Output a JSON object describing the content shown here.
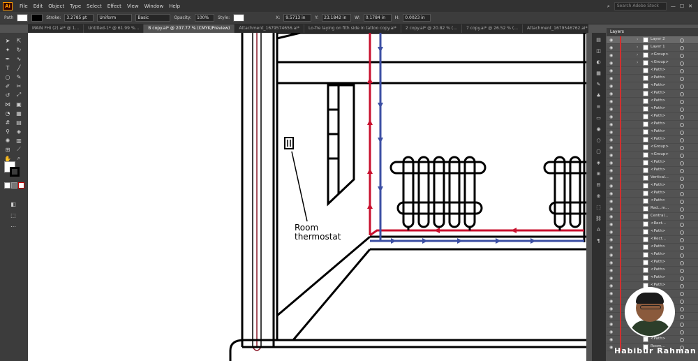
{
  "app": {
    "logo": "Ai"
  },
  "menu": [
    "File",
    "Edit",
    "Object",
    "Type",
    "Select",
    "Effect",
    "View",
    "Window",
    "Help"
  ],
  "search": {
    "placeholder": "Search Adobe Stock"
  },
  "control_bar": {
    "path_label": "Path",
    "stroke_label": "Stroke:",
    "stroke_value": "3.2785 pt",
    "profile": "Uniform",
    "brush": "Basic",
    "opacity_label": "Opacity:",
    "opacity_value": "100%",
    "style_label": "Style:",
    "x_label": "X:",
    "x_value": "9.5713 in",
    "y_label": "Y:",
    "y_value": "23.1842 in",
    "w_label": "W:",
    "w_value": "0.1784 in",
    "h_label": "H:",
    "h_value": "0.0023 in"
  },
  "tabs": [
    {
      "label": "MAIN FHI (2).ai* @ 1...",
      "active": false
    },
    {
      "label": "Untitled-1* @ 61.99 %...",
      "active": false
    },
    {
      "label": "B copy.ai* @ 207.77 % (CMYK/Preview)",
      "active": true
    },
    {
      "label": "Attachment_1679574656.ai*",
      "active": false
    },
    {
      "label": "Lo-Tre laying on fith side in tattoo copy.ai*",
      "active": false
    },
    {
      "label": "2 copy.ai* @ 20.82 % (...",
      "active": false
    },
    {
      "label": "7 copy.ai* @ 26.52 % (...",
      "active": false
    },
    {
      "label": "Attachment_1679546762.ai*",
      "active": false
    }
  ],
  "canvas": {
    "thermostat_label_line1": "Room",
    "thermostat_label_line2": "thermostat"
  },
  "layers_panel": {
    "title": "Layers",
    "rows": [
      {
        "name": "Layer 2",
        "sel": true
      },
      {
        "name": "Layer 1",
        "sel": false
      },
      {
        "name": "<Group>",
        "sel": false
      },
      {
        "name": "<Group>",
        "sel": false
      },
      {
        "name": "<Path>",
        "sel": false
      },
      {
        "name": "<Path>",
        "sel": false
      },
      {
        "name": "<Path>",
        "sel": false
      },
      {
        "name": "<Path>",
        "sel": false
      },
      {
        "name": "<Path>",
        "sel": false
      },
      {
        "name": "<Path>",
        "sel": false
      },
      {
        "name": "<Path>",
        "sel": false
      },
      {
        "name": "<Path>",
        "sel": false
      },
      {
        "name": "<Path>",
        "sel": false
      },
      {
        "name": "<Path>",
        "sel": false
      },
      {
        "name": "<Group>",
        "sel": false
      },
      {
        "name": "<Group>",
        "sel": false
      },
      {
        "name": "<Path>",
        "sel": false
      },
      {
        "name": "<Path>",
        "sel": false
      },
      {
        "name": "Vertical...",
        "sel": false
      },
      {
        "name": "<Path>",
        "sel": false
      },
      {
        "name": "<Path>",
        "sel": false
      },
      {
        "name": "<Path>",
        "sel": false
      },
      {
        "name": "Rad...m...",
        "sel": false
      },
      {
        "name": "Central...",
        "sel": false
      },
      {
        "name": "<Rect...",
        "sel": false
      },
      {
        "name": "<Path>",
        "sel": false
      },
      {
        "name": "<Rect...",
        "sel": false
      },
      {
        "name": "<Path>",
        "sel": false
      },
      {
        "name": "<Path>",
        "sel": false
      },
      {
        "name": "<Path>",
        "sel": false
      },
      {
        "name": "<Path>",
        "sel": false
      },
      {
        "name": "<Path>",
        "sel": false
      },
      {
        "name": "<Path>",
        "sel": false
      },
      {
        "name": "<Path>",
        "sel": false
      },
      {
        "name": "<Path>",
        "sel": false
      },
      {
        "name": "<Path>",
        "sel": false
      },
      {
        "name": "<Path>",
        "sel": false
      },
      {
        "name": "<Path>",
        "sel": false
      },
      {
        "name": "<Path>",
        "sel": false
      },
      {
        "name": "<Path>",
        "sel": false
      },
      {
        "name": "Room...",
        "sel": false
      }
    ]
  },
  "watermark": "Habibur Rahman",
  "colors": {
    "hot_pipe": "#c8102e",
    "cold_pipe": "#3b4ea3"
  }
}
